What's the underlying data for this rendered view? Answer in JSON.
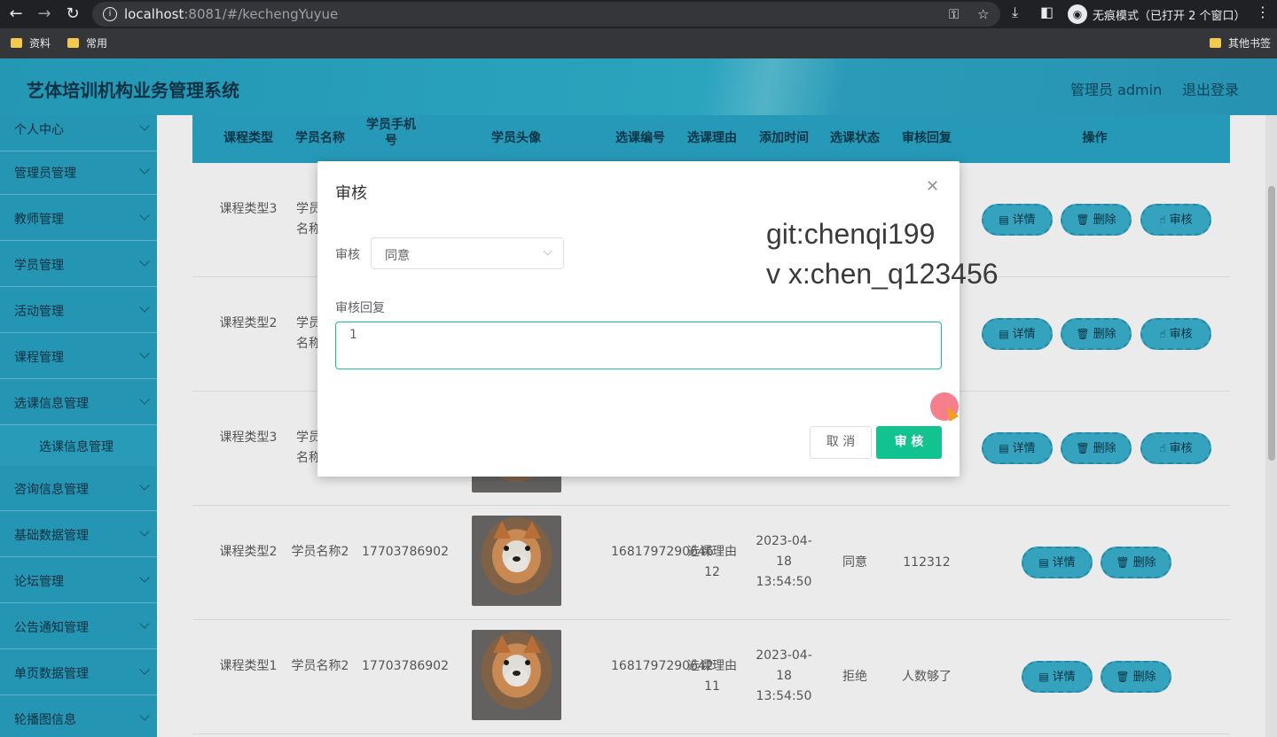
{
  "browser": {
    "url_host": "localhost",
    "url_rest": ":8081/#/kechengYuyue",
    "incognito_label": "无痕模式（已打开 2 个窗口）",
    "bookmarks": [
      "资料",
      "常用"
    ],
    "other_bookmarks": "其他书签"
  },
  "header": {
    "title": "艺体培训机构业务管理系统",
    "admin_label": "管理员 admin",
    "logout_label": "退出登录"
  },
  "sidebar": {
    "items": [
      "个人中心",
      "管理员管理",
      "教师管理",
      "学员管理",
      "活动管理",
      "课程管理",
      "选课信息管理"
    ],
    "sub_item": "选课信息管理",
    "items_after": [
      "咨询信息管理",
      "基础数据管理",
      "论坛管理",
      "公告通知管理",
      "单页数据管理",
      "轮播图信息"
    ]
  },
  "table": {
    "columns": [
      "课程类型",
      "学员名称",
      "学员手机号",
      "学员头像",
      "选课编号",
      "选课理由",
      "添加时间",
      "选课状态",
      "审核回复",
      "操作"
    ],
    "rows": [
      {
        "course_type": "课程类型3",
        "student": "学员名称"
      },
      {
        "course_type": "课程类型2",
        "student": "学员名称"
      },
      {
        "course_type": "课程类型3",
        "student": "学员名称"
      },
      {
        "course_type": "课程类型2",
        "student": "学员名称2",
        "phone": "17703786902",
        "number": "1681797290646",
        "reason": "选课理由12",
        "time": "2023-04-18 13:54:50",
        "status": "同意",
        "reply": "112312"
      },
      {
        "course_type": "课程类型1",
        "student": "学员名称2",
        "phone": "17703786902",
        "number": "1681797290642",
        "reason": "选课理由11",
        "time": "2023-04-18 13:54:50",
        "status": "拒绝",
        "reply": "人数够了"
      }
    ],
    "actions": {
      "detail": "详情",
      "delete": "删除",
      "review": "审核"
    }
  },
  "dialog": {
    "title": "审核",
    "field_review_label": "审核",
    "field_review_value": "同意",
    "field_reply_label": "审核回复",
    "field_reply_value": "1",
    "cancel_label": "取 消",
    "submit_label": "审 核"
  },
  "watermark": {
    "line1": "git:chenqi199",
    "line2": "v x:chen_q123456"
  },
  "colors": {
    "accent": "#2aa6c8",
    "submit": "#12c28f",
    "focus_border": "#1abc9c"
  }
}
